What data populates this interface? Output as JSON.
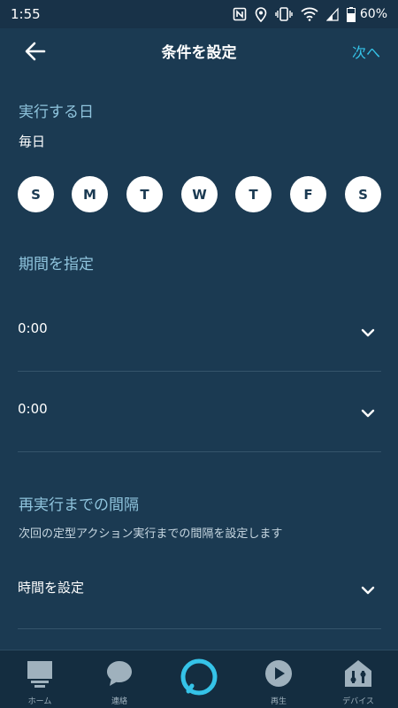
{
  "status_bar": {
    "time": "1:55",
    "battery_percent": "60%",
    "icons": [
      "nfc-icon",
      "location-icon",
      "vibrate-icon",
      "wifi-icon",
      "signal-icon",
      "battery-icon"
    ]
  },
  "header": {
    "title": "条件を設定",
    "next_label": "次へ",
    "accent_color": "#35c3e8"
  },
  "schedule": {
    "heading": "実行する日",
    "frequency": "毎日",
    "days": [
      "S",
      "M",
      "T",
      "W",
      "T",
      "F",
      "S"
    ]
  },
  "period": {
    "heading": "期間を指定",
    "start_time": "0:00",
    "end_time": "0:00"
  },
  "interval": {
    "heading": "再実行までの間隔",
    "description": "次回の定型アクション実行までの間隔を設定します",
    "setting_label": "時間を設定"
  },
  "bottom_nav": {
    "items": [
      {
        "label": "ホーム",
        "icon": "home-icon"
      },
      {
        "label": "連絡",
        "icon": "chat-icon"
      },
      {
        "label": "",
        "icon": "alexa-icon"
      },
      {
        "label": "再生",
        "icon": "play-icon"
      },
      {
        "label": "デバイス",
        "icon": "devices-icon"
      }
    ]
  },
  "colors": {
    "background": "#1b3a52",
    "heading": "#8fc4dd",
    "accent": "#35c3e8"
  }
}
